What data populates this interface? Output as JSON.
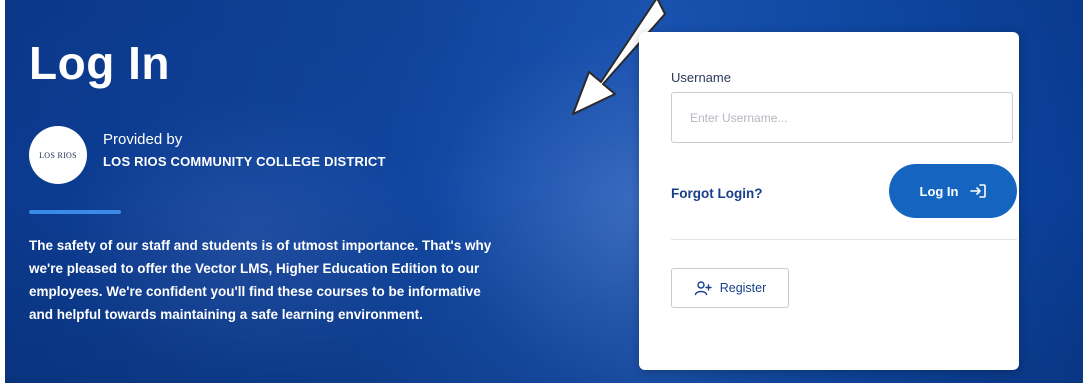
{
  "hero": {
    "title": "Log In",
    "provided_by": "Provided by",
    "provider_name": "LOS RIOS COMMUNITY COLLEGE DISTRICT",
    "logo_text": "LOS RIOS",
    "description": "The safety of our staff and students is of utmost importance. That's why we're pleased to offer the Vector LMS, Higher Education Edition to our employees. We're confident you'll find these courses to be informative and helpful towards maintaining a safe learning environment."
  },
  "login_form": {
    "username_label": "Username",
    "username_value": "",
    "username_placeholder": "Enter Username...",
    "forgot_login": "Forgot Login?",
    "login_button_label": "Log In",
    "login_icon": "login-arrow-icon",
    "register_button_label": "Register",
    "register_icon": "add-user-icon"
  },
  "colors": {
    "background_blue": "#10459e",
    "accent_bar": "#3a8be8",
    "primary_button": "#1565c0",
    "link": "#173f8c"
  },
  "annotation": {
    "arrow_icon": "pointer-arrow-icon"
  }
}
